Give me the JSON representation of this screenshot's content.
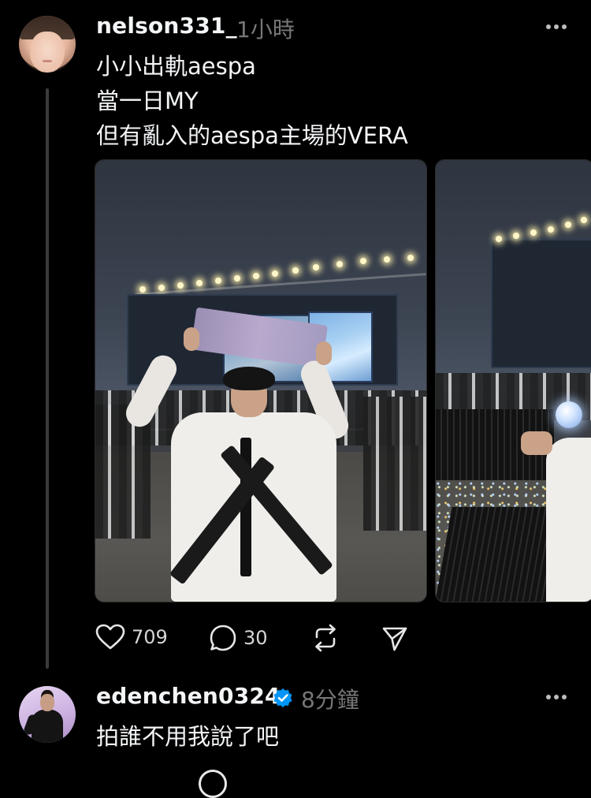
{
  "post": {
    "username": "nelson331_",
    "timestamp": "1小時",
    "lines": [
      "小小出軌aespa",
      "當一日MY",
      "但有亂入的aespa主場的VERA"
    ],
    "likes": "709",
    "comments": "30",
    "avatar_icon": "profile-photo",
    "more_icon": "more-dots-icon"
  },
  "reply": {
    "username": "edenchen0324",
    "timestamp": "8分鐘",
    "verified": true,
    "text": "拍誰不用我說了吧"
  },
  "colors": {
    "background": "#000000",
    "text_primary": "#f3f5f7",
    "text_secondary": "#777777",
    "verified_blue": "#0095f6",
    "thread_line": "#3b3b3b"
  }
}
